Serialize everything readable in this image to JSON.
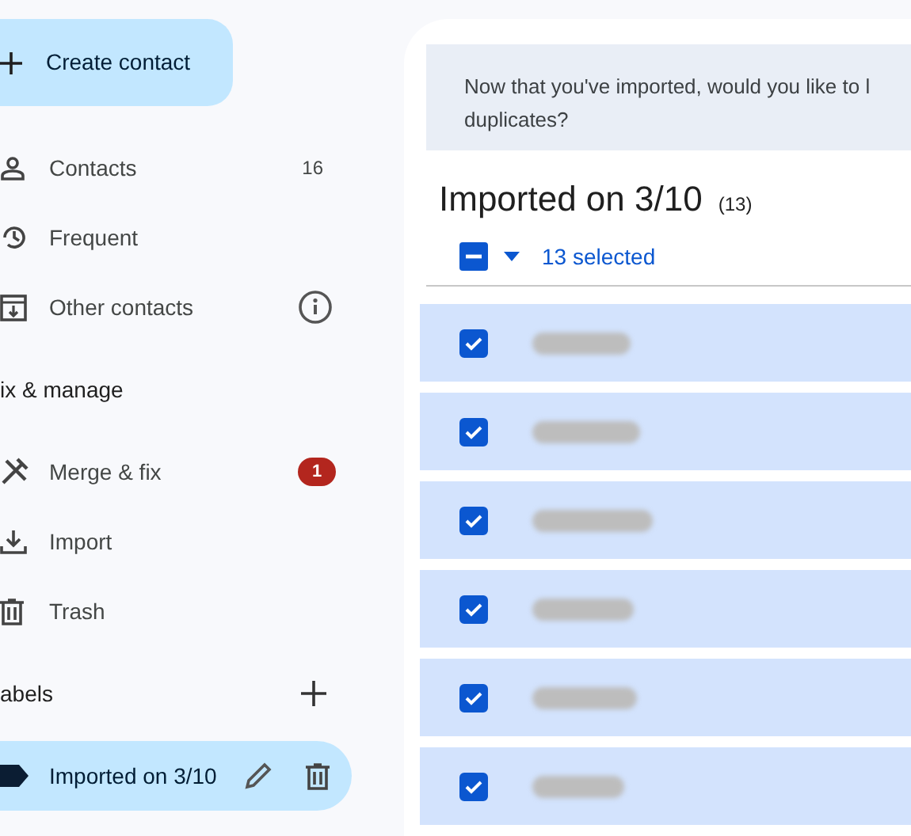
{
  "sidebar": {
    "create_button": {
      "label": "Create contact"
    },
    "items": [
      {
        "label": "Contacts",
        "count": "16",
        "selected": false
      },
      {
        "label": "Frequent",
        "selected": false
      },
      {
        "label": "Other contacts",
        "info_icon": true,
        "selected": false
      }
    ],
    "fix_section": {
      "title": "ix & manage",
      "items": [
        {
          "label": "Merge & fix",
          "badge": "1",
          "selected": false
        },
        {
          "label": "Import",
          "selected": false
        },
        {
          "label": "Trash",
          "selected": false
        }
      ]
    },
    "labels_section": {
      "title": "abels",
      "items": [
        {
          "label": "Imported on 3/10",
          "selected": true
        }
      ]
    }
  },
  "main": {
    "banner": "Now that you've imported, would you like to l duplicates?",
    "title": "Imported on 3/10",
    "count": "(13)",
    "selection": {
      "label": "13 selected",
      "partial": true
    },
    "rows": [
      {
        "selected": true
      },
      {
        "selected": true
      },
      {
        "selected": true
      },
      {
        "selected": true
      },
      {
        "selected": true
      },
      {
        "selected": true
      }
    ]
  }
}
